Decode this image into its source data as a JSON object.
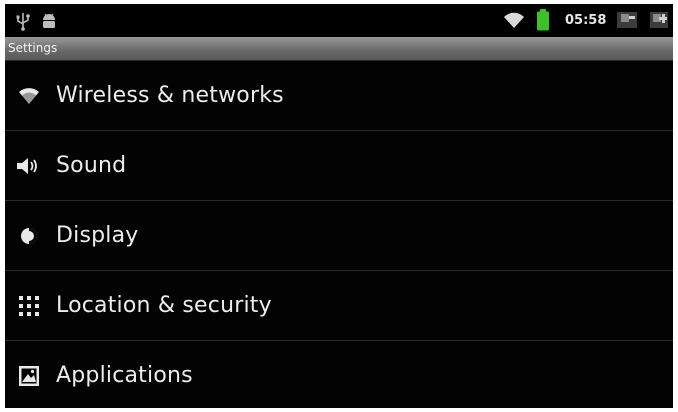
{
  "status_bar": {
    "time": "05:58",
    "icons": [
      "usb-icon",
      "android-debug-icon",
      "wifi-signal-icon",
      "battery-icon",
      "back-key-icon",
      "menu-key-icon"
    ],
    "battery_color": "#3fbf2a"
  },
  "title_bar": {
    "title": "Settings"
  },
  "settings_list": [
    {
      "label": "Wireless & networks",
      "icon": "wifi-icon"
    },
    {
      "label": "Sound",
      "icon": "speaker-icon"
    },
    {
      "label": "Display",
      "icon": "brightness-icon"
    },
    {
      "label": "Location & security",
      "icon": "grid-icon"
    },
    {
      "label": "Applications",
      "icon": "applications-icon"
    }
  ]
}
